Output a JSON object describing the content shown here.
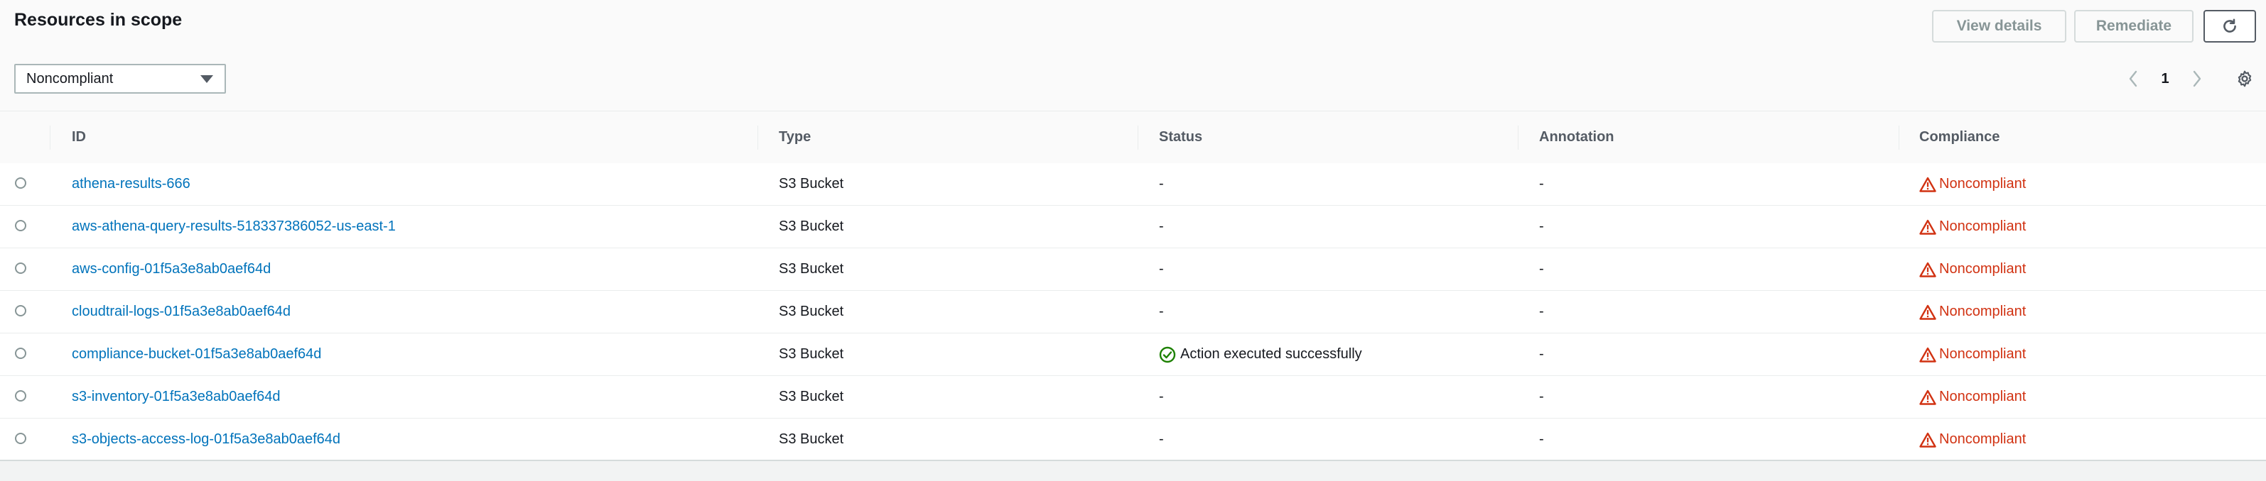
{
  "header": {
    "title": "Resources in scope",
    "view_details_label": "View details",
    "remediate_label": "Remediate"
  },
  "filter": {
    "selected": "Noncompliant"
  },
  "pagination": {
    "current_page": "1"
  },
  "table": {
    "columns": {
      "id": "ID",
      "type": "Type",
      "status": "Status",
      "annotation": "Annotation",
      "compliance": "Compliance"
    },
    "rows": [
      {
        "id": "athena-results-666",
        "type": "S3 Bucket",
        "status": "-",
        "annotation": "-",
        "compliance": "Noncompliant"
      },
      {
        "id": "aws-athena-query-results-518337386052-us-east-1",
        "type": "S3 Bucket",
        "status": "-",
        "annotation": "-",
        "compliance": "Noncompliant"
      },
      {
        "id": "aws-config-01f5a3e8ab0aef64d",
        "type": "S3 Bucket",
        "status": "-",
        "annotation": "-",
        "compliance": "Noncompliant"
      },
      {
        "id": "cloudtrail-logs-01f5a3e8ab0aef64d",
        "type": "S3 Bucket",
        "status": "-",
        "annotation": "-",
        "compliance": "Noncompliant"
      },
      {
        "id": "compliance-bucket-01f5a3e8ab0aef64d",
        "type": "S3 Bucket",
        "status": "Action executed successfully",
        "annotation": "-",
        "compliance": "Noncompliant"
      },
      {
        "id": "s3-inventory-01f5a3e8ab0aef64d",
        "type": "S3 Bucket",
        "status": "-",
        "annotation": "-",
        "compliance": "Noncompliant"
      },
      {
        "id": "s3-objects-access-log-01f5a3e8ab0aef64d",
        "type": "S3 Bucket",
        "status": "-",
        "annotation": "-",
        "compliance": "Noncompliant"
      }
    ]
  },
  "colors": {
    "link": "#0073bb",
    "noncompliant": "#d13212",
    "success": "#1d8102"
  },
  "icons": {
    "refresh": "refresh-icon",
    "dropdown": "caret-down-icon",
    "prev": "chevron-left-icon",
    "next": "chevron-right-icon",
    "settings": "gear-icon",
    "noncompliant": "warning-icon",
    "success": "check-circle-icon"
  }
}
